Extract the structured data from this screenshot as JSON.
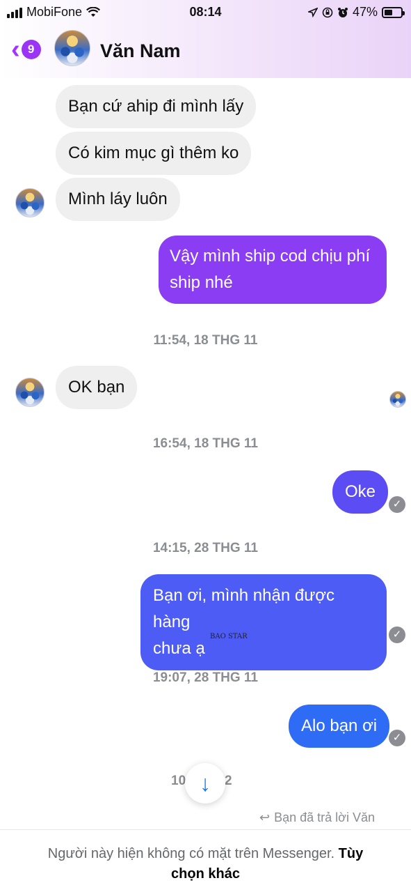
{
  "status_bar": {
    "carrier": "MobiFone",
    "time": "08:14",
    "battery": "47%"
  },
  "header": {
    "unread_count": "9",
    "contact_name": "Văn Nam"
  },
  "messages": [
    {
      "text": "Bạn cứ ahip đi mình lấy"
    },
    {
      "text": "Có kim mục gì thêm ko"
    },
    {
      "text": "Mình láy luôn"
    },
    {
      "text_line1": "Vậy mình ship cod chịu phí",
      "text_line2": "ship nhé"
    },
    {
      "timestamp": "11:54, 18 THG 11"
    },
    {
      "text": "OK bạn"
    },
    {
      "timestamp": "16:54, 18 THG 11"
    },
    {
      "text": "Oke"
    },
    {
      "timestamp": "14:15, 28 THG 11"
    },
    {
      "text_line1": "Bạn ơi, mình nhận được hàng",
      "text_line2": "chưa ạ"
    },
    {
      "timestamp": "19:07, 28 THG 11"
    },
    {
      "text": "Alo bạn ơi"
    }
  ],
  "partial_timestamp": {
    "left": "10",
    "right": "2"
  },
  "watermark": "BAO STAR",
  "replied_note": "Bạn đã trả lời Văn",
  "footer": {
    "text": "Người này hiện không có mặt trên Messenger.",
    "link_part1": "Tùy",
    "link_part2": "chọn khác"
  },
  "colors": {
    "accent_purple": "#9b34f5",
    "bubble_out_1": "#8a3df2",
    "bubble_out_2": "#5b4df3",
    "bubble_out_3": "#4e5cf6",
    "bubble_out_4": "#2f6cf6"
  },
  "icons": [
    "signal-icon",
    "wifi-icon",
    "location-icon",
    "lock-rotation-icon",
    "alarm-icon",
    "battery-icon",
    "back-chevron-icon",
    "seen-check-icon",
    "scroll-down-arrow-icon",
    "reply-arrow-icon"
  ]
}
